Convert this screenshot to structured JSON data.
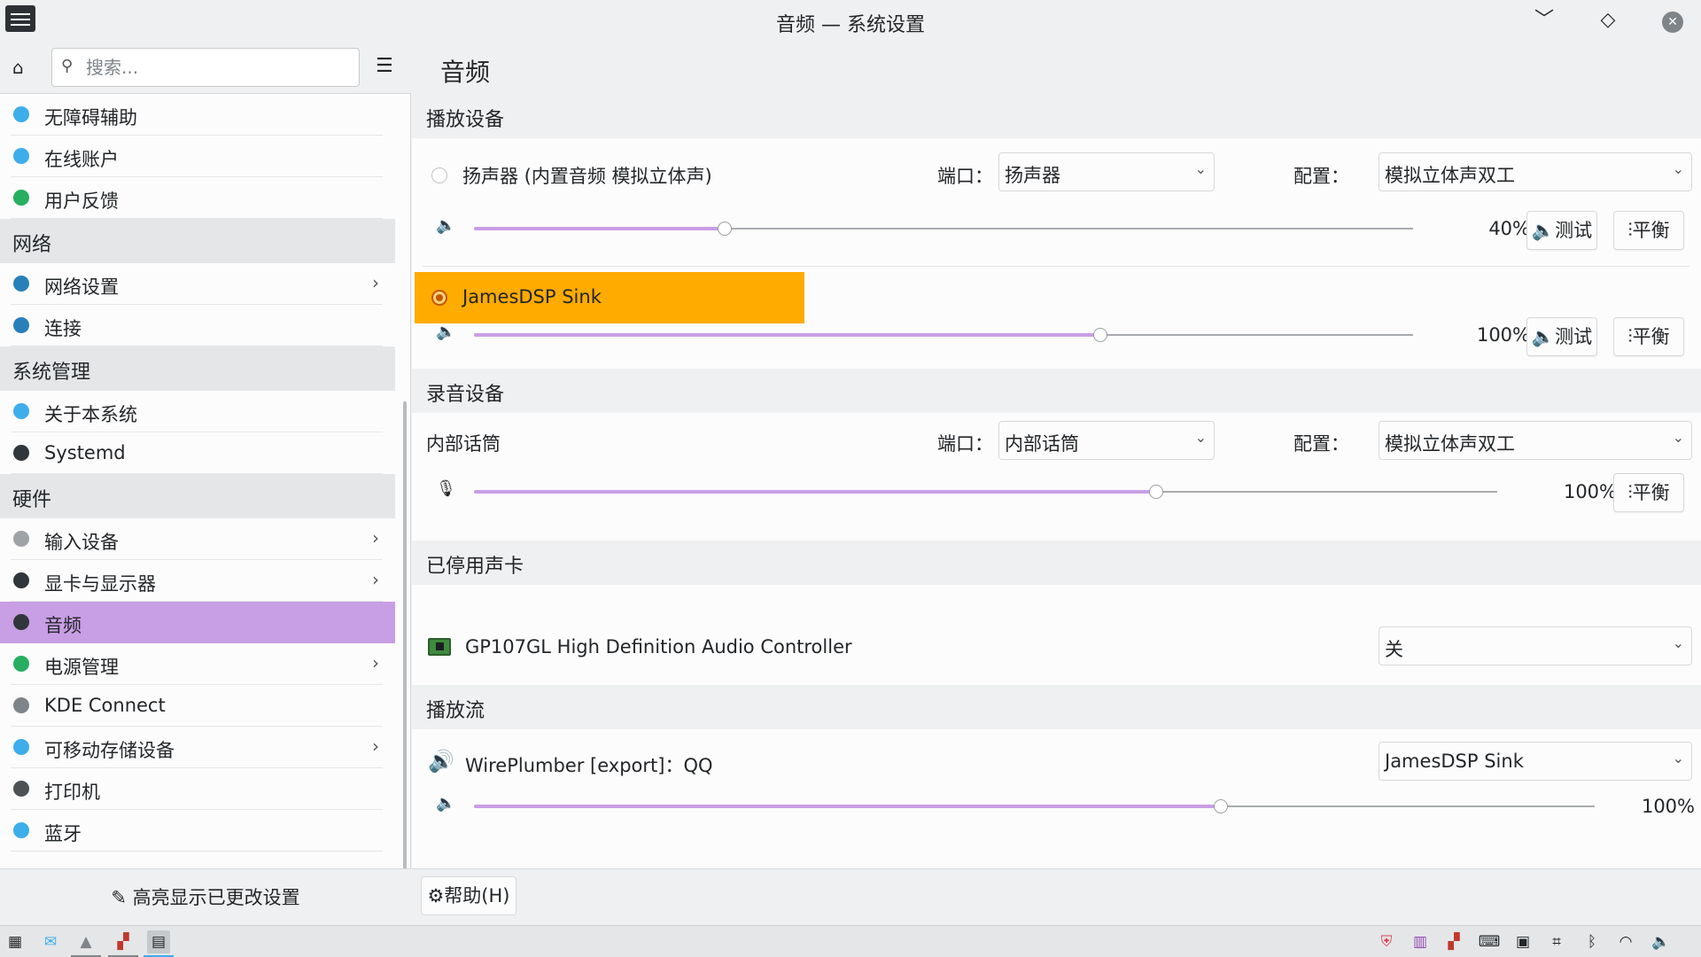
{
  "window": {
    "title": "音频 — 系统设置",
    "minimize_icon": "﹀",
    "maximize_icon": "◇",
    "close_icon": "✕"
  },
  "sidebar": {
    "search_placeholder": "搜索...",
    "highlight_changed": "✎ 高亮显示已更改设置",
    "entries": [
      {
        "kind": "item",
        "label": "无障碍辅助",
        "icon": "accessibility-icon",
        "color": "#3daee9",
        "chevron": false
      },
      {
        "kind": "item",
        "label": "在线账户",
        "icon": "online-accounts-icon",
        "color": "#3daee9",
        "chevron": false
      },
      {
        "kind": "item",
        "label": "用户反馈",
        "icon": "feedback-icon",
        "color": "#27ae60",
        "chevron": false
      },
      {
        "kind": "category",
        "label": "网络"
      },
      {
        "kind": "item",
        "label": "网络设置",
        "icon": "network-globe-icon",
        "color": "#2980b9",
        "chevron": true
      },
      {
        "kind": "item",
        "label": "连接",
        "icon": "connections-globe-icon",
        "color": "#2980b9",
        "chevron": false
      },
      {
        "kind": "category",
        "label": "系统管理"
      },
      {
        "kind": "item",
        "label": "关于本系统",
        "icon": "info-icon",
        "color": "#3daee9",
        "chevron": false
      },
      {
        "kind": "item",
        "label": "Systemd",
        "icon": "systemd-icon",
        "color": "#31363b",
        "chevron": false
      },
      {
        "kind": "category",
        "label": "硬件"
      },
      {
        "kind": "item",
        "label": "输入设备",
        "icon": "mouse-icon",
        "color": "#a0a3a6",
        "chevron": true
      },
      {
        "kind": "item",
        "label": "显卡与显示器",
        "icon": "monitor-icon",
        "color": "#31363b",
        "chevron": true
      },
      {
        "kind": "item",
        "label": "音频",
        "icon": "audio-icon",
        "color": "#31363b",
        "chevron": false,
        "active": true
      },
      {
        "kind": "item",
        "label": "电源管理",
        "icon": "power-icon",
        "color": "#27ae60",
        "chevron": true
      },
      {
        "kind": "item",
        "label": "KDE Connect",
        "icon": "kde-connect-icon",
        "color": "#7f8489",
        "chevron": false
      },
      {
        "kind": "item",
        "label": "可移动存储设备",
        "icon": "usb-storage-icon",
        "color": "#3daee9",
        "chevron": true
      },
      {
        "kind": "item",
        "label": "打印机",
        "icon": "printer-icon",
        "color": "#4d5154",
        "chevron": false
      },
      {
        "kind": "item",
        "label": "蓝牙",
        "icon": "bluetooth-icon",
        "color": "#3daee9",
        "chevron": false
      }
    ]
  },
  "content": {
    "title": "音频",
    "sections": {
      "playback": "播放设备",
      "recording": "录音设备",
      "disabled_cards": "已停用声卡",
      "streams": "播放流"
    },
    "port_label": "端口：",
    "profile_label": "配置：",
    "test_label": "🔈测试",
    "balance_label": "⫶平衡",
    "playback_devices": [
      {
        "name": "扬声器 (内置音频 模拟立体声)",
        "port": "扬声器",
        "profile": "模拟立体声双工",
        "volume": 40,
        "volume_text": "40%",
        "default": false
      },
      {
        "name": "JamesDSP Sink",
        "volume": 100,
        "volume_text": "100%",
        "default": true,
        "highlight_color": "#ffab00"
      }
    ],
    "recording_device": {
      "name": "内部话筒",
      "port": "内部话筒",
      "profile": "模拟立体声双工",
      "volume": 100,
      "volume_text": "100%"
    },
    "disabled_card": {
      "name": "GP107GL High Definition Audio Controller",
      "state": "关"
    },
    "stream": {
      "name": "WirePlumber [export]：QQ",
      "target": "JamesDSP Sink",
      "volume": 100,
      "volume_text": "100%"
    },
    "help_label": "⚙帮助(H)"
  },
  "taskbar": {
    "launcher_icon": "application-launcher-icon",
    "tray_icons": [
      "security-shield-icon",
      "audio-mixer-icon",
      "app-m-icon",
      "terminal-icon",
      "clipboard-icon",
      "keyboard-icon",
      "bluetooth-icon",
      "wifi-icon",
      "volume-icon"
    ]
  }
}
